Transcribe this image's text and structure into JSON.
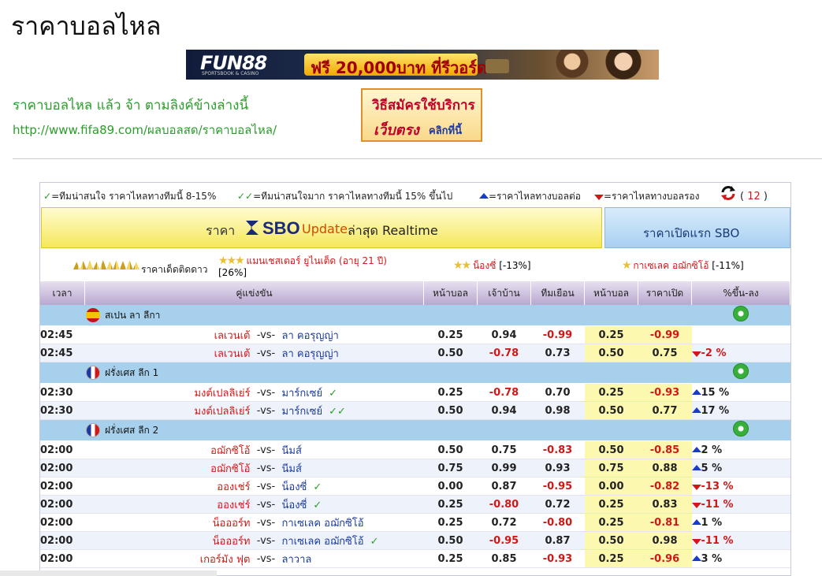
{
  "page": {
    "title": "ราคาบอลไหล"
  },
  "banner": {
    "logo": "FUN88",
    "logo_sub": "SPORTSBOOK & CASINO",
    "promo": "ฟรี 20,000บาท ที่รีวอร์ด"
  },
  "intro": {
    "line1": "ราคาบอลไหล แล้ว จ้า ตามลิงค์ข้างล่างนี้",
    "url": "http://www.fifa89.com/ผลบอลสด/ราคาบอลไหล/"
  },
  "signup": {
    "line1": "วิธีสมัครใช้บริการ",
    "line2": "เว็บตรง",
    "line3": "คลิกที่นี้"
  },
  "legend": {
    "one_check": "=ทีมน่าสนใจ ราคาไหลทางทีมนี้ 8-15%",
    "two_check": "=ทีมน่าสนใจมาก ราคาไหลทางทีมนี้ 15% ขึ้นไป",
    "up": "=ราคาไหลทางบอลต่อ",
    "down": "=ราคาไหลทางบอลรอง",
    "refresh_count": "12"
  },
  "tabs": {
    "sbo_prefix": "ราคา",
    "sbo_brand": "SBO",
    "sbo_update": "Update",
    "sbo_suffix": "ล่าสุด Realtime",
    "open_label": "ราคาเปิดแรก SBO"
  },
  "stars": {
    "rating_label": "ราคาเด็ดติดดาว",
    "fav1_stars": "★★★",
    "fav1_name": "แมนเชสเตอร์ ยูไนเต็ด (อายุ 21 ปี)",
    "fav1_pct": "[26%]",
    "fav2_stars": "★★",
    "fav2_name": "น็องซี่",
    "fav2_pct": "[-13%]",
    "fav3_stars": "★",
    "fav3_name": "กาเซเลค อฌักซิโอ้",
    "fav3_pct": "[-11%]"
  },
  "table": {
    "headers": [
      "เวลา",
      "คู่แข่งขัน",
      "หน้าบอล",
      "เจ้าบ้าน",
      "ทีมเยือน",
      "หน้าบอล",
      "ราคาเปิด",
      "%ขึ้น-ลง"
    ],
    "vs": "-vs-",
    "leagues": [
      {
        "name": "สเปน ลา ลีกา",
        "flag": "spain-flag"
      },
      {
        "name": "ฝรั่งเศส ลีก 1",
        "flag": "france-flag"
      },
      {
        "name": "ฝรั่งเศส ลีก 2",
        "flag": "france-flag"
      }
    ],
    "rows": [
      {
        "time": "02:45",
        "home": "เลเวนเต้",
        "away": "ลา คอรุญญ่า",
        "hdp": "0.25",
        "h": "0.94",
        "a": "-0.99",
        "ohdp": "0.25",
        "open": "-0.99",
        "chg": ""
      },
      {
        "time": "02:45",
        "home": "เลเวนเต้",
        "away": "ลา คอรุญญ่า",
        "hdp": "0.50",
        "h": "-0.78",
        "a": "0.73",
        "ohdp": "0.50",
        "open": "0.75",
        "chg": "-2 %"
      },
      {
        "time": "02:30",
        "home": "มงต์เปลลิเย่ร์",
        "away": "มาร์กเซย์",
        "hdp": "0.25",
        "h": "-0.78",
        "a": "0.70",
        "ohdp": "0.25",
        "open": "-0.93",
        "chg": "15 %"
      },
      {
        "time": "02:30",
        "home": "มงต์เปลลิเย่ร์",
        "away": "มาร์กเซย์",
        "hdp": "0.50",
        "h": "0.94",
        "a": "0.98",
        "ohdp": "0.50",
        "open": "0.77",
        "chg": "17 %"
      },
      {
        "time": "02:00",
        "home": "อฌักซิโอ้",
        "away": "นีมส์",
        "hdp": "0.50",
        "h": "0.75",
        "a": "-0.83",
        "ohdp": "0.50",
        "open": "-0.85",
        "chg": "2 %"
      },
      {
        "time": "02:00",
        "home": "อฌักซิโอ้",
        "away": "นีมส์",
        "hdp": "0.75",
        "h": "0.99",
        "a": "0.93",
        "ohdp": "0.75",
        "open": "0.88",
        "chg": "5 %"
      },
      {
        "time": "02:00",
        "home": "อองเช่ร์",
        "away": "น็องซี่",
        "hdp": "0.00",
        "h": "0.87",
        "a": "-0.95",
        "ohdp": "0.00",
        "open": "-0.82",
        "chg": "-13 %"
      },
      {
        "time": "02:00",
        "home": "อองเช่ร์",
        "away": "น็องซี่",
        "hdp": "0.25",
        "h": "-0.80",
        "a": "0.72",
        "ohdp": "0.25",
        "open": "0.83",
        "chg": "-11 %"
      },
      {
        "time": "02:00",
        "home": "น็อออร์ท",
        "away": "กาเซเลค อฌักซิโอ้",
        "hdp": "0.25",
        "h": "0.72",
        "a": "-0.80",
        "ohdp": "0.25",
        "open": "-0.81",
        "chg": "1 %"
      },
      {
        "time": "02:00",
        "home": "น็อออร์ท",
        "away": "กาเซเลค อฌักซิโอ้",
        "hdp": "0.50",
        "h": "-0.95",
        "a": "0.87",
        "ohdp": "0.50",
        "open": "0.98",
        "chg": "-11 %"
      },
      {
        "time": "02:00",
        "home": "เกอร์มัง ฟุต",
        "away": "ลาวาล",
        "hdp": "0.25",
        "h": "0.85",
        "a": "-0.93",
        "ohdp": "0.25",
        "open": "-0.96",
        "chg": "3 %"
      }
    ]
  },
  "colors": {
    "green_text": "#2a9d2a",
    "red": "#d01818",
    "blue": "#1a3aa0",
    "league_bg": "#a7d0ec",
    "open_bg": "#fdf8b0"
  }
}
